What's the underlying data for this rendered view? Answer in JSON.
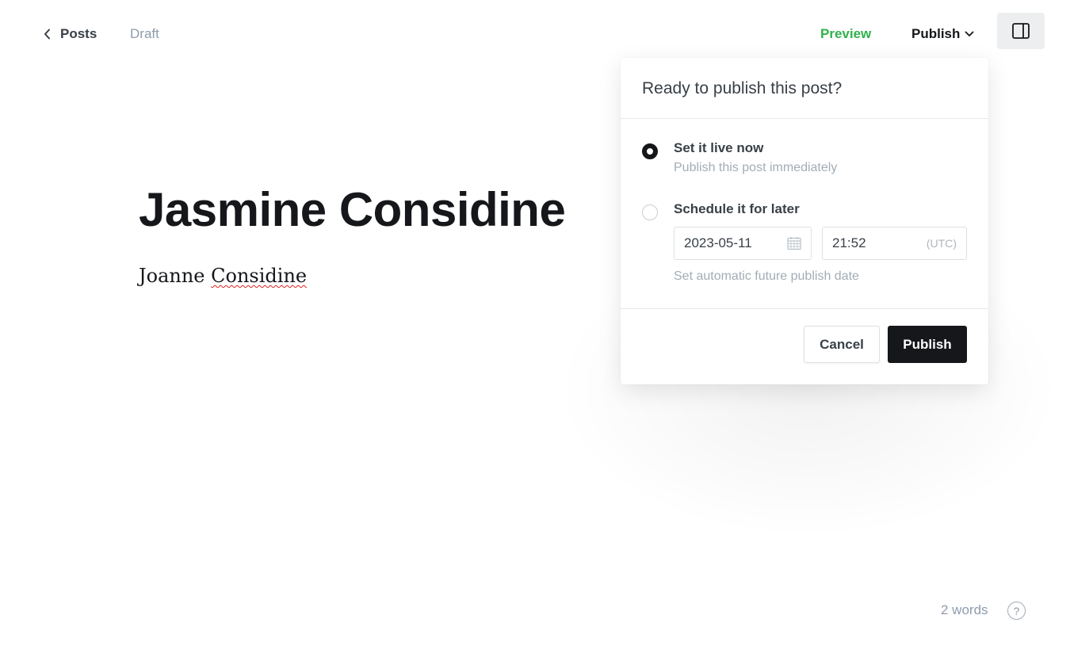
{
  "header": {
    "back_label": "Posts",
    "status": "Draft",
    "preview_label": "Preview",
    "publish_label": "Publish",
    "back_icon": "chevron-left-icon",
    "publish_menu_icon": "chevron-down-icon",
    "sidebar_icon": "sidebar-panel-icon"
  },
  "post": {
    "title": "Jasmine Considine",
    "body_first_word": "Joanne",
    "body_second_word": "Considine"
  },
  "publish_popover": {
    "title": "Ready to publish this post?",
    "options": [
      {
        "label": "Set it live now",
        "hint": "Publish this post immediately",
        "selected": true
      },
      {
        "label": "Schedule it for later",
        "hint": "Set automatic future publish date",
        "selected": false
      }
    ],
    "schedule": {
      "date": "2023-05-11",
      "time": "21:52",
      "timezone": "(UTC)",
      "date_icon": "calendar-icon"
    },
    "cancel_label": "Cancel",
    "confirm_label": "Publish"
  },
  "footer": {
    "word_count": "2 words",
    "help_glyph": "?",
    "help_icon": "help-circle-icon"
  },
  "colors": {
    "accent_green": "#2fb34a",
    "primary_dark": "#15171a",
    "muted_text": "#8e9cac",
    "spellcheck_underline": "#e02020"
  }
}
